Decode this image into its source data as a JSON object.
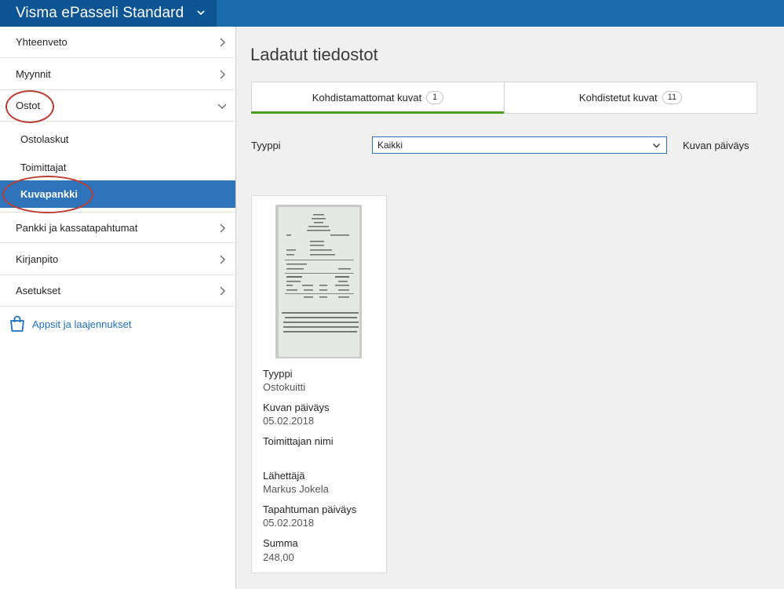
{
  "app": {
    "title": "Visma ePasseli Standard"
  },
  "sidebar": {
    "items": [
      {
        "label": "Yhteenveto"
      },
      {
        "label": "Myynnit"
      },
      {
        "label": "Ostot"
      },
      {
        "label": "Pankki ja kassatapahtumat"
      },
      {
        "label": "Kirjanpito"
      },
      {
        "label": "Asetukset"
      }
    ],
    "subitems": [
      {
        "label": "Ostolaskut"
      },
      {
        "label": "Toimittajat"
      },
      {
        "label": "Kuvapankki"
      }
    ],
    "apps_link": "Appsit ja laajennukset"
  },
  "main": {
    "title": "Ladatut tiedostot",
    "tabs": [
      {
        "label": "Kohdistamattomat kuvat",
        "count": "1"
      },
      {
        "label": "Kohdistetut kuvat",
        "count": "11"
      }
    ],
    "filter": {
      "label": "Tyyppi",
      "value": "Kaikki"
    },
    "date_filter_label": "Kuvan päiväys",
    "card": {
      "fields": [
        {
          "label": "Tyyppi",
          "value": "Ostokuitti"
        },
        {
          "label": "Kuvan päiväys",
          "value": "05.02.2018"
        },
        {
          "label": "Toimittajan nimi",
          "value": ""
        },
        {
          "label": "Lähettäjä",
          "value": "Markus Jokela"
        },
        {
          "label": "Tapahtuman päiväys",
          "value": "05.02.2018"
        },
        {
          "label": "Summa",
          "value": "248,00"
        }
      ]
    }
  },
  "colors": {
    "topbar": "#1a6bab",
    "topbar_dark": "#0d5592",
    "active_nav": "#2f74bb",
    "active_tab_underline": "#4c9a1e",
    "link": "#1f6fc0",
    "annotation": "#b83d33"
  },
  "icons": [
    "chevron-down-icon",
    "chevron-right-icon",
    "shopping-bag-icon"
  ]
}
